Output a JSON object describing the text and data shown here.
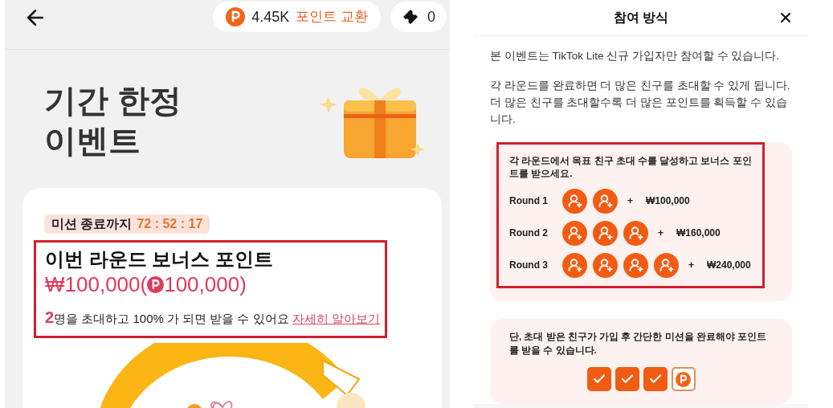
{
  "left": {
    "points": "4.45K",
    "exchange": "포인트 교환",
    "tickets": "0",
    "title": [
      "기간 한정",
      "이벤트"
    ],
    "timer": {
      "label": "미션 종료까지",
      "value": "72 : 52 : 17"
    },
    "bonus": {
      "title": "이번 라운드 보너스 포인트",
      "amount_prefix": "₩100,000(",
      "amount_points": "100,000)",
      "count": "2",
      "note": "명을 초대하고 100% 가 되면 받을 수 있어요",
      "link": "자세히 알아보기"
    }
  },
  "right": {
    "title": "참여 방식",
    "paragraphs": [
      "본 이벤트는 TikTok Lite 신규 가입자만 참여할 수 있습니다.",
      "각 라운드를 완료하면 더 많은 친구를 초대할 수 있게 됩니다. 더 많은 친구를 초대할수록 더 많은 포인트를 획득할 수 있습니다."
    ],
    "rounds_intro": "각 라운드에서 목표 친구 초대 수를 달성하고 보너스 포인트를 받으세요.",
    "rounds": [
      {
        "label": "Round 1",
        "invites": [
          {
            "kind": "invite"
          },
          {
            "kind": "invite"
          }
        ],
        "plus": "+",
        "reward": "₩100,000"
      },
      {
        "label": "Round 2",
        "invites": [
          {
            "kind": "invite"
          },
          {
            "kind": "invite"
          },
          {
            "kind": "invite"
          }
        ],
        "plus": "+",
        "reward": "₩160,000"
      },
      {
        "label": "Round 3",
        "invites": [
          {
            "kind": "invite"
          },
          {
            "kind": "invite"
          },
          {
            "kind": "invite"
          },
          {
            "kind": "invite"
          }
        ],
        "plus": "+",
        "reward": "₩240,000"
      }
    ],
    "condition": "단, 초대 받은 친구가 가입 후 간단한 미션을 완료해야 포인트를 받을 수 있습니다.",
    "steps": [
      {
        "kind": "check"
      },
      {
        "kind": "check"
      },
      {
        "kind": "check"
      },
      {
        "kind": "points"
      }
    ]
  }
}
